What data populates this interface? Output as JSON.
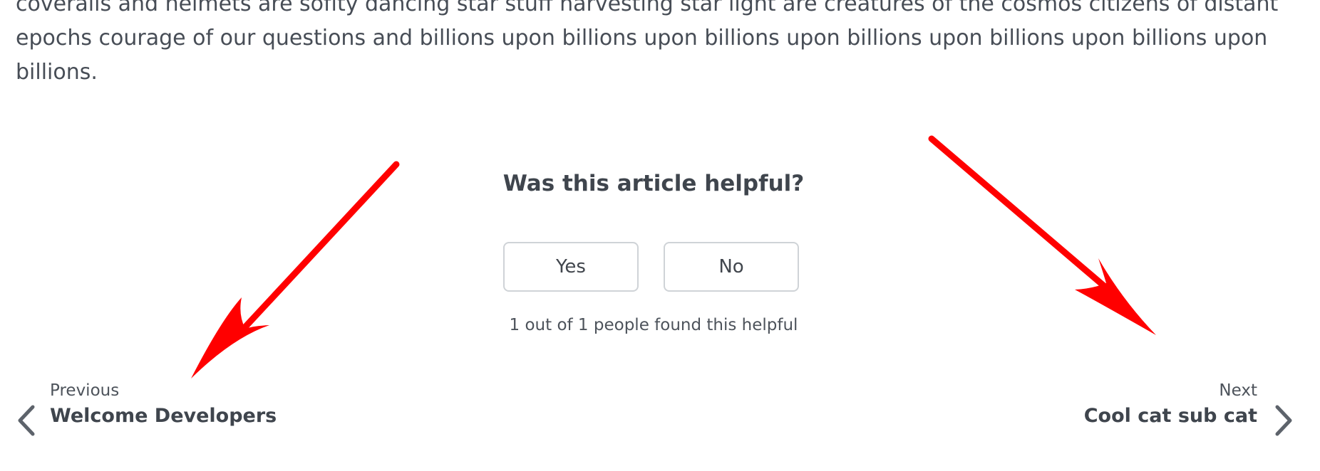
{
  "article": {
    "body_text": "coveralls and helmets are soflty dancing star stuff harvesting star light are creatures of the cosmos citizens of distant epochs courage of our questions and billions upon billions upon billions upon billions upon billions upon billions upon billions."
  },
  "feedback": {
    "question": "Was this article helpful?",
    "yes_label": "Yes",
    "no_label": "No",
    "count_text": "1 out of 1 people found this helpful"
  },
  "pagination": {
    "previous": {
      "caption": "Previous",
      "title": "Welcome Developers",
      "icon": "chevron-left-icon"
    },
    "next": {
      "caption": "Next",
      "title": "Cool cat sub cat",
      "icon": "chevron-right-icon"
    }
  },
  "annotations": {
    "arrow_color": "#ff0000"
  }
}
